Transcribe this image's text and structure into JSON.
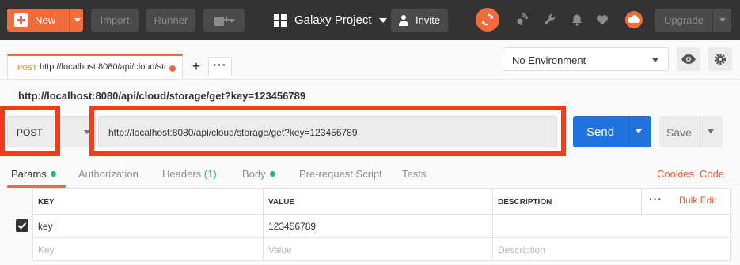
{
  "topbar": {
    "new_label": "New",
    "import_label": "Import",
    "runner_label": "Runner",
    "workspace_name": "Galaxy Project",
    "invite_label": "Invite",
    "upgrade_label": "Upgrade",
    "accent_color": "#f26b3a"
  },
  "tabs": {
    "active": {
      "method": "POST",
      "url": "http://localhost:8080/api/cloud/storage/get?key=123456789",
      "unsaved": true
    }
  },
  "environment": {
    "selected": "No Environment"
  },
  "request": {
    "title": "http://localhost:8080/api/cloud/storage/get?key=123456789",
    "method": "POST",
    "url": "http://localhost:8080/api/cloud/storage/get?key=123456789",
    "send_label": "Send",
    "save_label": "Save",
    "send_color": "#1f72db"
  },
  "subtabs": {
    "params": "Params",
    "authorization": "Authorization",
    "headers": "Headers",
    "headers_count": "(1)",
    "body": "Body",
    "prerequest": "Pre-request Script",
    "tests": "Tests",
    "cookies": "Cookies",
    "code": "Code"
  },
  "params_table": {
    "headers": {
      "key": "KEY",
      "value": "VALUE",
      "description": "DESCRIPTION"
    },
    "bulk_edit": "Bulk Edit",
    "rows": [
      {
        "key": "key",
        "value": "123456789",
        "description": "",
        "enabled": true
      }
    ],
    "placeholders": {
      "key": "Key",
      "value": "Value",
      "description": "Description"
    }
  }
}
